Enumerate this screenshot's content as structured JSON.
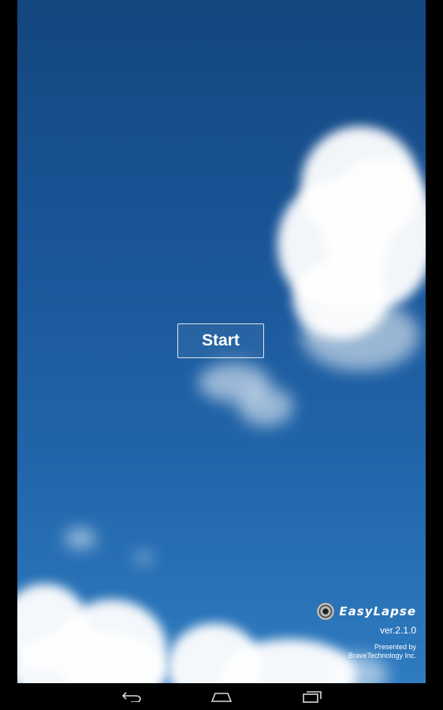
{
  "start_button": {
    "label": "Start"
  },
  "brand": {
    "name": "EasyLapse",
    "version": "ver.2.1.0",
    "presented_line1": "Presented by",
    "presented_line2": "BraveTechnology Inc."
  },
  "navbar": {
    "icons": [
      "back-icon",
      "home-icon",
      "recents-icon"
    ]
  }
}
